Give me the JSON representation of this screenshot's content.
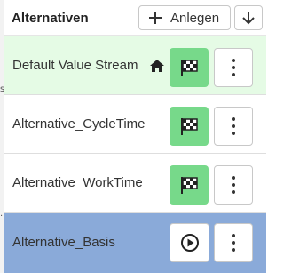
{
  "header": {
    "title": "Alternativen",
    "add_label": "Anlegen",
    "add_icon": "plus-icon",
    "sort_icon": "arrow-down-icon"
  },
  "alternatives": [
    {
      "label": "Default Value Stream",
      "is_default": true,
      "action_icon": "checkered-flag-icon",
      "state": "finished",
      "selected": false
    },
    {
      "label": "Alternative_CycleTime",
      "is_default": false,
      "action_icon": "checkered-flag-icon",
      "state": "finished",
      "selected": false
    },
    {
      "label": "Alternative_WorkTime",
      "is_default": false,
      "action_icon": "checkered-flag-icon",
      "state": "finished",
      "selected": false
    },
    {
      "label": "Alternative_Basis",
      "is_default": false,
      "action_icon": "play-circle-icon",
      "state": "ready",
      "selected": true
    }
  ],
  "colors": {
    "default_row_bg": "#e5fbe5",
    "selected_row_bg": "#8aaad9",
    "flag_button_bg": "#77d98a",
    "border": "#c8c8c8"
  }
}
